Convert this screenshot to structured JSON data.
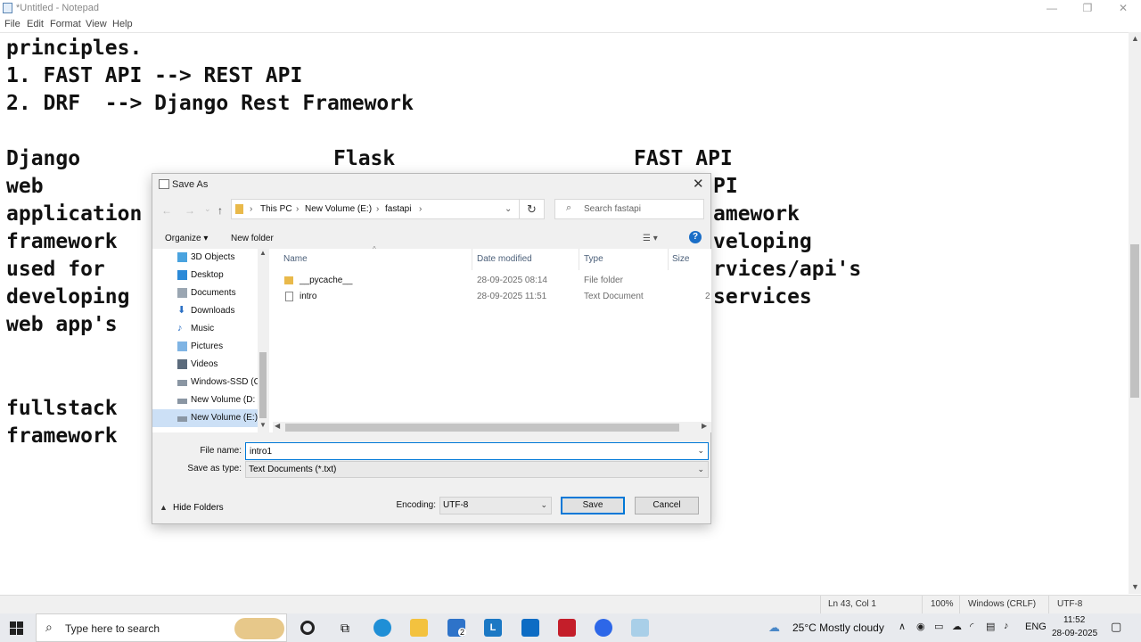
{
  "notepad": {
    "title": "*Untitled - Notepad",
    "menu": [
      "File",
      "Edit",
      "Format",
      "View",
      "Help"
    ],
    "lines": [
      "principles.",
      "1. FAST API --> REST API",
      "2. DRF  --> Django Rest Framework",
      "Django",
      "Flask",
      "FAST API",
      "web",
      "PI",
      "application",
      "amework",
      "framework",
      "veloping",
      "used for",
      "rvices/api's",
      "developing",
      "services",
      "web app's",
      "fullstack",
      "framework"
    ],
    "status": {
      "position": "Ln 43, Col 1",
      "zoom": "100%",
      "line_ending": "Windows (CRLF)",
      "encoding": "UTF-8"
    }
  },
  "dialog": {
    "title": "Save As",
    "breadcrumb": [
      "This PC",
      "New Volume (E:)",
      "fastapi"
    ],
    "search_placeholder": "Search fastapi",
    "organize": "Organize ▾",
    "new_folder": "New folder",
    "help": "?",
    "nav_items": [
      "3D Objects",
      "Desktop",
      "Documents",
      "Downloads",
      "Music",
      "Pictures",
      "Videos",
      "Windows-SSD (C",
      "New Volume (D:",
      "New Volume (E:)"
    ],
    "columns": [
      "Name",
      "Date modified",
      "Type",
      "Size"
    ],
    "files": [
      {
        "name": "__pycache__",
        "date": "28-09-2025 08:14",
        "type": "File folder",
        "size": ""
      },
      {
        "name": "intro",
        "date": "28-09-2025 11:51",
        "type": "Text Document",
        "size": "2"
      }
    ],
    "file_name_label": "File name:",
    "file_name_value": "intro1",
    "save_type_label": "Save as type:",
    "save_type_value": "Text Documents (*.txt)",
    "hide_folders": "Hide Folders",
    "encoding_label": "Encoding:",
    "encoding_value": "UTF-8",
    "save": "Save",
    "cancel": "Cancel"
  },
  "taskbar": {
    "search_placeholder": "Type here to search",
    "weather": "25°C  Mostly cloudy",
    "language": "ENG",
    "time": "11:52",
    "date": "28-09-2025",
    "mail_badge": "2"
  },
  "colors": {
    "selection": "#cce0f6",
    "accent": "#0078d7"
  }
}
